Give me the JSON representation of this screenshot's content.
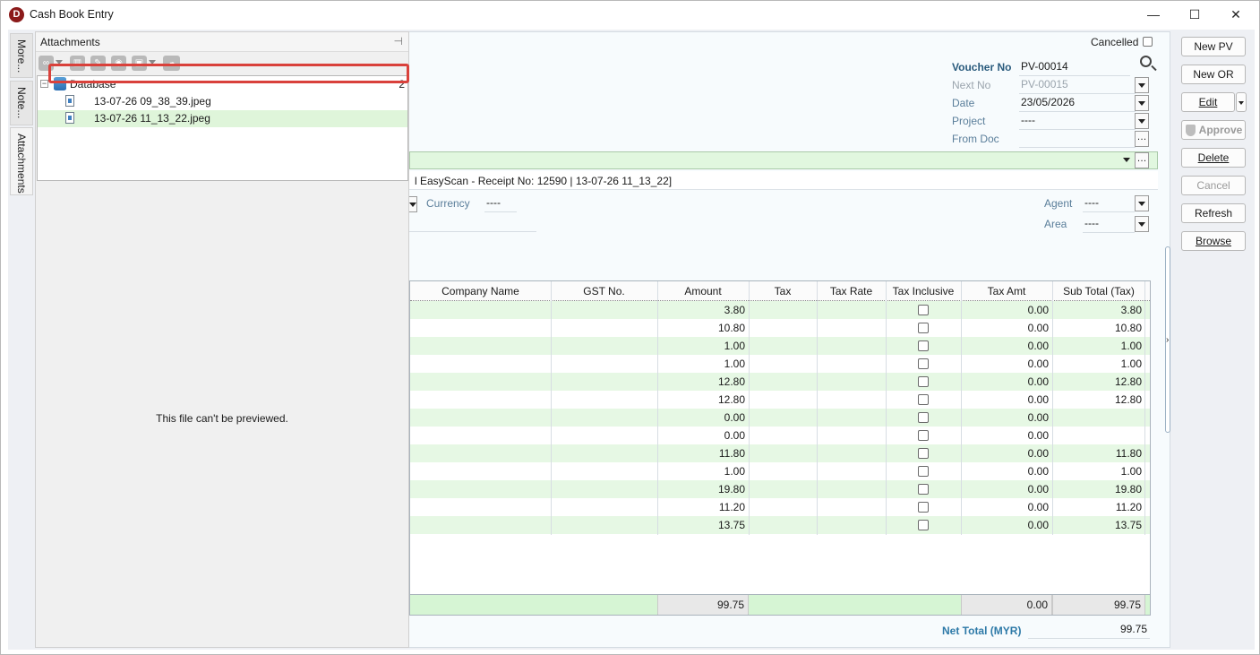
{
  "window": {
    "title": "Cash Book Entry",
    "logo_letter": "D",
    "minimize": "—",
    "maximize": "☐",
    "close": "✕"
  },
  "side_tabs": [
    "More...",
    "Note...",
    "Attachments"
  ],
  "attachments": {
    "title": "Attachments",
    "tree": {
      "root": "Database",
      "count": "2",
      "files": [
        "13-07-26 09_38_39.jpeg",
        "13-07-26 11_13_22.jpeg"
      ]
    },
    "preview_message": "This file can't be previewed."
  },
  "header": {
    "cancelled_label": "Cancelled",
    "voucher_no_label": "Voucher No",
    "voucher_no": "PV-00014",
    "next_no_label": "Next No",
    "next_no": "PV-00015",
    "date_label": "Date",
    "date": "23/05/2026",
    "project_label": "Project",
    "project": "----",
    "from_doc_label": "From Doc",
    "from_doc": ""
  },
  "description": "l EasyScan - Receipt No: 12590 | 13-07-26 11_13_22]",
  "currency_label": "Currency",
  "currency": "----",
  "agent_label": "Agent",
  "agent": "----",
  "area_label": "Area",
  "area": "----",
  "grid": {
    "columns": [
      "Company Name",
      "GST No.",
      "Amount",
      "Tax",
      "Tax Rate",
      "Tax Inclusive",
      "Tax Amt",
      "Sub Total (Tax)"
    ],
    "rows": [
      {
        "amount": "3.80",
        "tax_amt": "0.00",
        "sub_total": "3.80"
      },
      {
        "amount": "10.80",
        "tax_amt": "0.00",
        "sub_total": "10.80"
      },
      {
        "amount": "1.00",
        "tax_amt": "0.00",
        "sub_total": "1.00"
      },
      {
        "amount": "1.00",
        "tax_amt": "0.00",
        "sub_total": "1.00"
      },
      {
        "amount": "12.80",
        "tax_amt": "0.00",
        "sub_total": "12.80"
      },
      {
        "amount": "12.80",
        "tax_amt": "0.00",
        "sub_total": "12.80"
      },
      {
        "amount": "0.00",
        "tax_amt": "0.00",
        "sub_total": ""
      },
      {
        "amount": "0.00",
        "tax_amt": "0.00",
        "sub_total": ""
      },
      {
        "amount": "11.80",
        "tax_amt": "0.00",
        "sub_total": "11.80"
      },
      {
        "amount": "1.00",
        "tax_amt": "0.00",
        "sub_total": "1.00"
      },
      {
        "amount": "19.80",
        "tax_amt": "0.00",
        "sub_total": "19.80"
      },
      {
        "amount": "11.20",
        "tax_amt": "0.00",
        "sub_total": "11.20"
      },
      {
        "amount": "13.75",
        "tax_amt": "0.00",
        "sub_total": "13.75"
      }
    ],
    "footer": {
      "amount": "99.75",
      "tax_amt": "0.00",
      "sub_total": "99.75"
    }
  },
  "net_total_label": "Net Total (MYR)",
  "net_total": "99.75",
  "buttons": {
    "new_pv": "New PV",
    "new_or": "New OR",
    "edit": "Edit",
    "approve": "Approve",
    "delete": "Delete",
    "cancel": "Cancel",
    "refresh": "Refresh",
    "browse": "Browse"
  }
}
